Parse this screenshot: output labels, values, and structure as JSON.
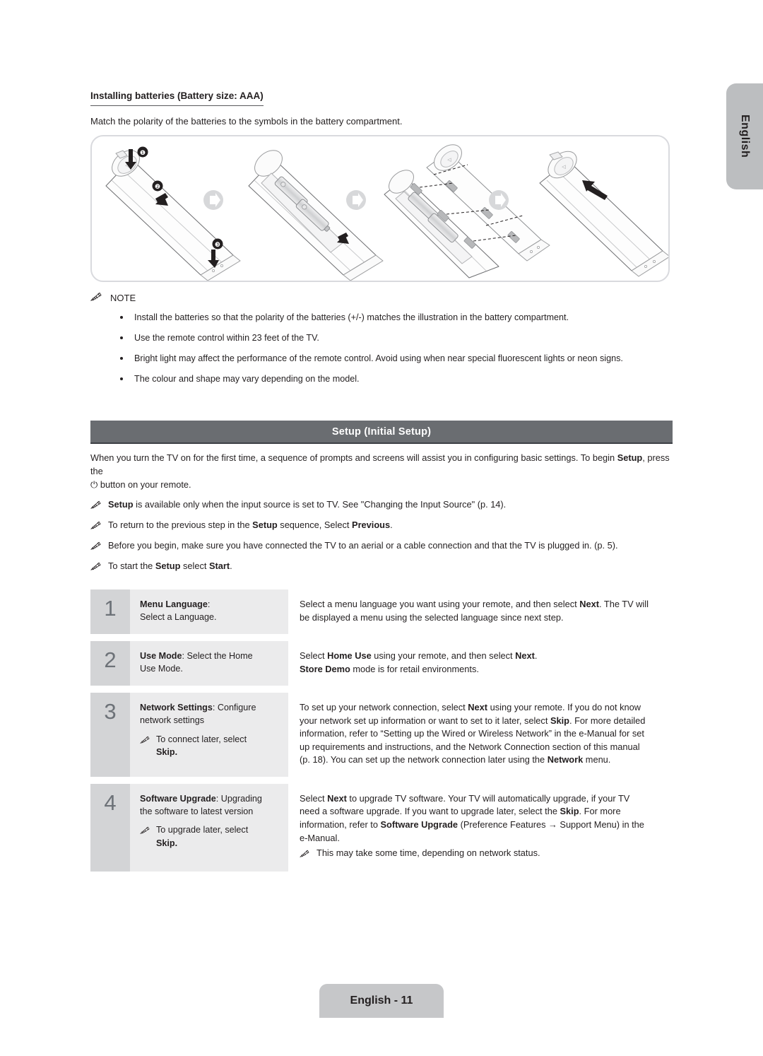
{
  "sidebar": {
    "language_tab": "English"
  },
  "battery_section": {
    "title": "Installing batteries (Battery size: AAA)",
    "subtitle": "Match the polarity of the batteries to the symbols in the battery compartment.",
    "illustration": {
      "name": "remote-battery-installation-diagram",
      "step_markers": [
        "1",
        "2",
        "3"
      ],
      "panels": 4,
      "arrow_separators": 3
    }
  },
  "note_section": {
    "heading": "NOTE",
    "icon": "pencil-icon",
    "items": [
      "Install the batteries so that the polarity of the batteries (+/-) matches the illustration in the battery compartment.",
      "Use the remote control within 23 feet of the TV.",
      "Bright light may affect the performance of the remote control. Avoid using when near special fluorescent lights or neon signs.",
      "The colour and shape may vary depending on the model."
    ]
  },
  "setup_section": {
    "bar_title": "Setup (Initial Setup)",
    "intro_a": "When you turn the TV on for the first time, a sequence of prompts and screens will assist you in configuring basic settings. To begin ",
    "intro_bold": "Setup",
    "intro_b": ", press the",
    "power_glyph": "⏻",
    "intro_c": " button on your remote.",
    "notes": [
      {
        "parts": [
          {
            "t": "Setup",
            "b": true
          },
          {
            "t": " is available only when the input source is set to TV. See \"Changing the Input Source\" (p. 14).",
            "b": false
          }
        ]
      },
      {
        "parts": [
          {
            "t": "To return to the previous step in the ",
            "b": false
          },
          {
            "t": "Setup",
            "b": true
          },
          {
            "t": " sequence, Select ",
            "b": false
          },
          {
            "t": "Previous",
            "b": true
          },
          {
            "t": ".",
            "b": false
          }
        ]
      },
      {
        "parts": [
          {
            "t": "Before you begin, make sure you have connected the TV to an aerial or a cable connection and that the TV is plugged in. (p. 5).",
            "b": false
          }
        ]
      },
      {
        "parts": [
          {
            "t": "To start the ",
            "b": false
          },
          {
            "t": "Setup",
            "b": true
          },
          {
            "t": " select ",
            "b": false
          },
          {
            "t": "Start",
            "b": true
          },
          {
            "t": ".",
            "b": false
          }
        ]
      }
    ]
  },
  "steps_table": {
    "rows": [
      {
        "number": "1",
        "label_bold": "Menu Language",
        "label_rest": ":",
        "label_line2": "Select a Language.",
        "mid_note": null,
        "mid_note_bold": null,
        "desc_parts": [
          {
            "t": "Select a menu language you want using your remote, and then select ",
            "b": false
          },
          {
            "t": "Next",
            "b": true
          },
          {
            "t": ". The TV will be displayed a menu using the selected language since next step.",
            "b": false
          }
        ],
        "desc_note": null
      },
      {
        "number": "2",
        "label_bold": "Use Mode",
        "label_rest": ": Select the Home",
        "label_line2": "Use Mode.",
        "mid_note": null,
        "mid_note_bold": null,
        "desc_parts": [
          {
            "t": "Select ",
            "b": false
          },
          {
            "t": "Home Use",
            "b": true
          },
          {
            "t": " using your remote, and then select ",
            "b": false
          },
          {
            "t": "Next",
            "b": true
          },
          {
            "t": ".",
            "b": false
          },
          {
            "t": "\n",
            "b": false
          },
          {
            "t": "Store Demo",
            "b": true
          },
          {
            "t": " mode is for retail environments.",
            "b": false
          }
        ],
        "desc_note": null
      },
      {
        "number": "3",
        "label_bold": "Network Settings",
        "label_rest": ": Configure",
        "label_line2": "network settings",
        "mid_note": "To connect later, select",
        "mid_note_bold": "Skip.",
        "desc_parts": [
          {
            "t": "To set up your network connection, select ",
            "b": false
          },
          {
            "t": "Next",
            "b": true
          },
          {
            "t": " using your remote. If you do not know your network set up information or want to set to it later, select ",
            "b": false
          },
          {
            "t": "Skip",
            "b": true
          },
          {
            "t": ". For more detailed information, refer to “Setting up the Wired or Wireless Network” in the e-Manual for set up requirements and instructions, and the Network Connection section of this manual (p. 18). You can set up the network connection later using the ",
            "b": false
          },
          {
            "t": "Network",
            "b": true
          },
          {
            "t": " menu.",
            "b": false
          }
        ],
        "desc_note": null
      },
      {
        "number": "4",
        "label_bold": "Software Upgrade",
        "label_rest": ": Upgrading",
        "label_line2": "the software to latest version",
        "mid_note": "To upgrade later, select",
        "mid_note_bold": "Skip.",
        "desc_parts": [
          {
            "t": "Select ",
            "b": false
          },
          {
            "t": "Next",
            "b": true
          },
          {
            "t": " to upgrade TV software. Your TV will automatically upgrade, if your TV need a software upgrade. If you want to upgrade later, select the ",
            "b": false
          },
          {
            "t": "Skip",
            "b": true
          },
          {
            "t": ". For more information, refer to ",
            "b": false
          },
          {
            "t": "Software Upgrade",
            "b": true
          },
          {
            "t": " (Preference Features → Support Menu) in the e-Manual.",
            "b": false
          }
        ],
        "desc_note": "This may take some time, depending on network status."
      }
    ]
  },
  "footer": {
    "page_label": "English - 11"
  },
  "colors": {
    "bar_background": "#6a6d71",
    "number_cell": "#d3d4d6",
    "middle_cell": "#ebebec",
    "side_tab": "#bcbec0",
    "footer_pill": "#c6c7c9",
    "text": "#231f20"
  }
}
